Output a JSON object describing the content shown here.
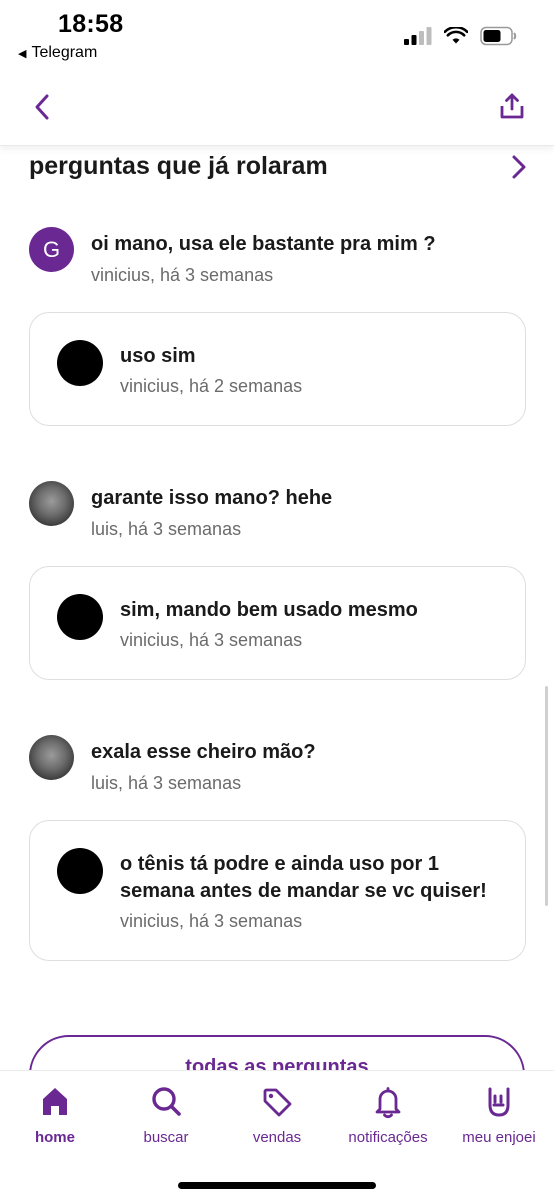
{
  "status_bar": {
    "time": "18:58",
    "back_app_label": "Telegram",
    "back_app_icon": "back-triangle-icon"
  },
  "colors": {
    "brand": "#6a2893",
    "text": "#1a1a1a",
    "muted": "#6b6b6b",
    "border": "#dedede"
  },
  "header": {
    "back_icon": "chevron-left-icon",
    "share_icon": "share-icon"
  },
  "section": {
    "title": "perguntas que já rolaram",
    "arrow_icon": "chevron-right-icon"
  },
  "qa": [
    {
      "question": {
        "avatar_letter": "G",
        "text": "oi mano, usa ele bastante pra mim ?",
        "meta": "vinicius, há 3 semanas"
      },
      "answer": {
        "text": "uso sim",
        "meta": "vinicius, há 2 semanas"
      }
    },
    {
      "question": {
        "avatar_letter": "",
        "text": "garante isso mano? hehe",
        "meta": "luis, há 3 semanas"
      },
      "answer": {
        "text": "sim, mando bem usado mesmo",
        "meta": "vinicius, há 3 semanas"
      }
    },
    {
      "question": {
        "avatar_letter": "",
        "text": "exala esse cheiro mão?",
        "meta": "luis, há 3 semanas"
      },
      "answer": {
        "text": "o tênis tá podre e ainda uso por 1 semana antes de mandar se vc quiser!",
        "meta": "vinicius, há 3 semanas"
      }
    }
  ],
  "all_questions_button": "todas as perguntas",
  "bottom_nav": [
    {
      "label": "home",
      "icon": "home-icon",
      "active": true
    },
    {
      "label": "buscar",
      "icon": "search-icon",
      "active": false
    },
    {
      "label": "vendas",
      "icon": "tag-icon",
      "active": false
    },
    {
      "label": "notificações",
      "icon": "bell-icon",
      "active": false
    },
    {
      "label": "meu enjoei",
      "icon": "rock-hand-icon",
      "active": false
    }
  ]
}
